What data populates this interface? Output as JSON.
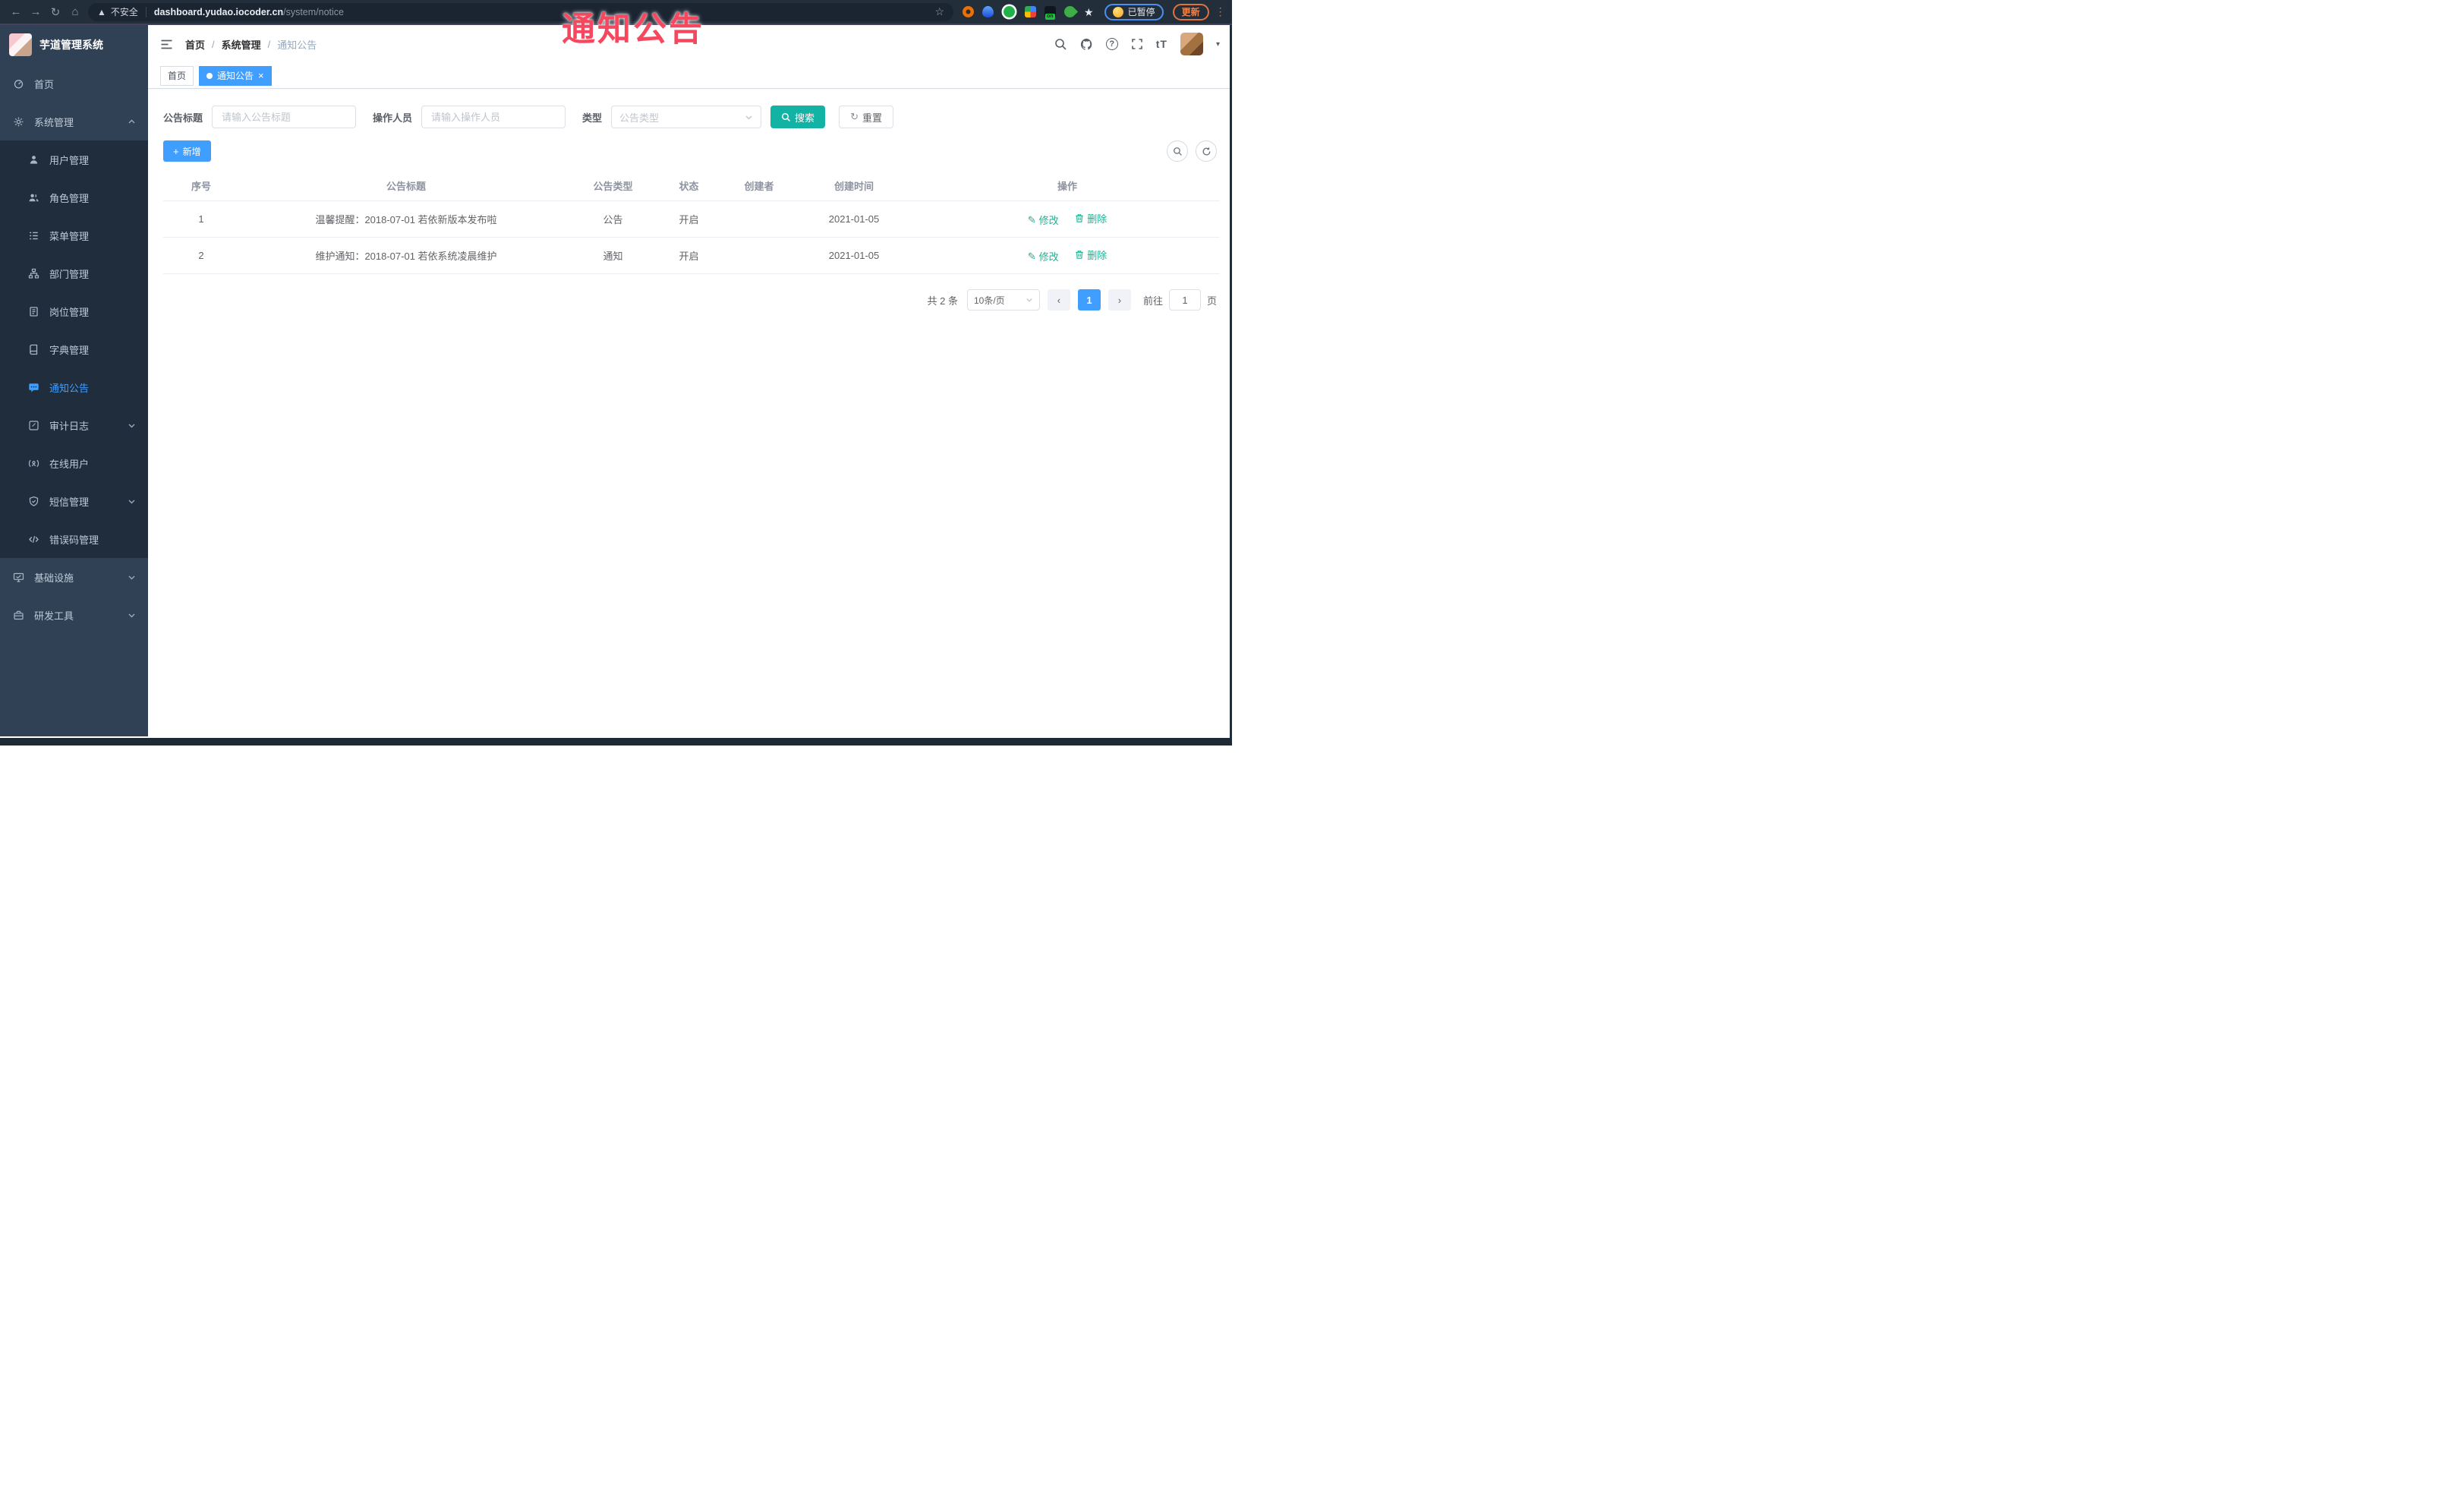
{
  "watermark": "通知公告",
  "browser": {
    "security_label": "不安全",
    "url_host": "dashboard.yudao.iocoder.cn",
    "url_path": "/system/notice",
    "extension_badge": "on",
    "paused_label": "已暂停",
    "update_label": "更新"
  },
  "sidebar": {
    "logo_title": "芋道管理系统",
    "items": [
      {
        "label": "首页"
      },
      {
        "label": "系统管理"
      },
      {
        "label": "用户管理"
      },
      {
        "label": "角色管理"
      },
      {
        "label": "菜单管理"
      },
      {
        "label": "部门管理"
      },
      {
        "label": "岗位管理"
      },
      {
        "label": "字典管理"
      },
      {
        "label": "通知公告"
      },
      {
        "label": "审计日志"
      },
      {
        "label": "在线用户"
      },
      {
        "label": "短信管理"
      },
      {
        "label": "错误码管理"
      },
      {
        "label": "基础设施"
      },
      {
        "label": "研发工具"
      }
    ]
  },
  "breadcrumb": {
    "home": "首页",
    "section": "系统管理",
    "current": "通知公告",
    "separator": "/"
  },
  "tabs": [
    {
      "label": "首页"
    },
    {
      "label": "通知公告"
    }
  ],
  "filters": {
    "title_label": "公告标题",
    "title_placeholder": "请输入公告标题",
    "operator_label": "操作人员",
    "operator_placeholder": "请输入操作人员",
    "type_label": "类型",
    "type_placeholder": "公告类型",
    "search_label": "搜索",
    "reset_label": "重置"
  },
  "toolbar": {
    "add_label": "新增"
  },
  "table": {
    "columns": [
      "序号",
      "公告标题",
      "公告类型",
      "状态",
      "创建者",
      "创建时间",
      "操作"
    ],
    "rows": [
      {
        "no": "1",
        "title": "温馨提醒：2018-07-01 若依新版本发布啦",
        "type": "公告",
        "status": "开启",
        "creator": "",
        "created": "2021-01-05"
      },
      {
        "no": "2",
        "title": "维护通知：2018-07-01 若依系统凌晨维护",
        "type": "通知",
        "status": "开启",
        "creator": "",
        "created": "2021-01-05"
      }
    ],
    "edit_label": "修改",
    "delete_label": "删除"
  },
  "pagination": {
    "total_text": "共 2 条",
    "page_size": "10条/页",
    "current_page": "1",
    "goto_label": "前往",
    "goto_value": "1",
    "page_suffix": "页"
  },
  "colors": {
    "primary_blue": "#409eff",
    "theme_teal": "#12b3a4",
    "action_green": "#17b394",
    "watermark_pink": "#f6475f",
    "sidebar_bg": "#304156",
    "sidebar_submenu_bg": "#1f2d3d",
    "sidebar_active_text": "#409eff"
  }
}
